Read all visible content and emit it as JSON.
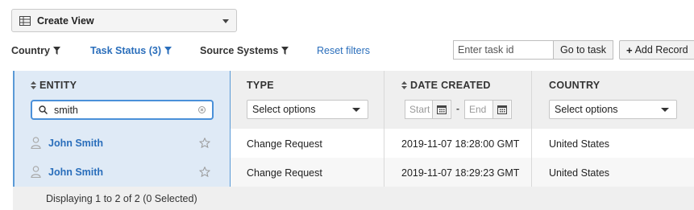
{
  "toolbar": {
    "view_label": "Create View"
  },
  "filters": [
    {
      "label": "Country",
      "active": false
    },
    {
      "label": "Task Status (3)",
      "active": true
    },
    {
      "label": "Source Systems",
      "active": false
    }
  ],
  "reset_label": "Reset filters",
  "task": {
    "placeholder": "Enter task id",
    "go_label": "Go to task",
    "add_label": "Add Record"
  },
  "columns": {
    "entity": "ENTITY",
    "type": "TYPE",
    "date": "DATE CREATED",
    "country": "COUNTRY"
  },
  "column_filters": {
    "entity_search": "smith",
    "type_select": "Select options",
    "date_start_placeholder": "Start",
    "date_end_placeholder": "End",
    "country_select": "Select options"
  },
  "rows": [
    {
      "entity": "John Smith",
      "type": "Change Request",
      "date": "2019-11-07 18:28:00 GMT",
      "country": "United States"
    },
    {
      "entity": "John Smith",
      "type": "Change Request",
      "date": "2019-11-07 18:29:23 GMT",
      "country": "United States"
    }
  ],
  "footer": {
    "status": "Displaying 1 to 2 of 2 (0 Selected)"
  },
  "colors": {
    "accent": "#2a6ebb",
    "selected_column": "#dfeaf6",
    "header_bg": "#efefef"
  },
  "icons": [
    "grid-icon",
    "caret-down-icon",
    "filter-icon",
    "sort-icon",
    "search-icon",
    "clear-icon",
    "calendar-icon",
    "person-icon",
    "star-icon",
    "plus-icon"
  ]
}
